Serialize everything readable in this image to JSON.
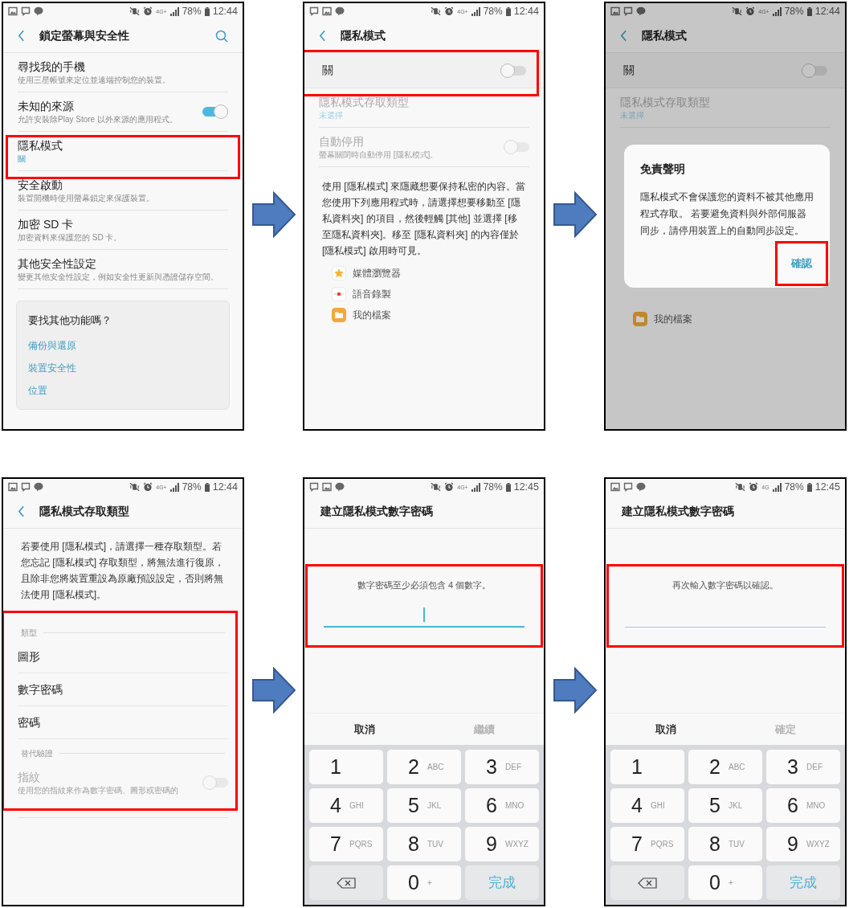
{
  "screens": [
    {
      "kind": "settings",
      "status": {
        "icons": [
          {
            "kind": "picture"
          },
          {
            "kind": "message"
          },
          {
            "kind": "chat"
          }
        ],
        "network": "4G+",
        "battery": "78%",
        "time": "12:44"
      },
      "title": "鎖定螢幕與安全性",
      "items": [
        {
          "title": "尋找我的手機",
          "summary": "使用三星帳號來定位並遠端控制您的裝置。",
          "disabled": false
        },
        {
          "title": "未知的來源",
          "summary": "允許安裝除Play Store 以外來源的應用程式。",
          "toggle": {
            "on": true
          },
          "disabled": false
        },
        {
          "title": "隱私模式",
          "value": "關",
          "disabled": false,
          "highlighted": true
        },
        {
          "title": "安全啟動",
          "summary": "裝置開機時使用螢幕鎖定來保護裝置。",
          "disabled": false
        },
        {
          "title": "加密 SD 卡",
          "summary": "加密資料來保護您的 SD 卡。",
          "disabled": false
        },
        {
          "title": "其他安全性設定",
          "summary": "變更其他安全性設定，例如安全性更新與憑證儲存空間。",
          "disabled": false
        }
      ],
      "card": {
        "title": "要找其他功能嗎？",
        "links": [
          "備份與還原",
          "裝置安全性",
          "位置"
        ]
      }
    },
    {
      "kind": "privacy",
      "status": {
        "icons": [
          {
            "kind": "message"
          },
          {
            "kind": "picture"
          },
          {
            "kind": "chat"
          }
        ],
        "network": "4G+",
        "battery": "78%",
        "time": "12:44"
      },
      "title": "隱私模式",
      "master": {
        "label": "關",
        "on": false,
        "highlighted": true
      },
      "items": [
        {
          "title": "隱私模式存取類型",
          "value": "未選擇",
          "disabled": true
        },
        {
          "title": "自動停用",
          "summary": "螢幕關閉時自動停用 [隱私模式]。",
          "toggle": {
            "on": false
          },
          "disabled": true
        }
      ],
      "description": "使用 [隱私模式] 來隱藏想要保持私密的內容。當您使用下列應用程式時，請選擇想要移動至 [隱私資料夾] 的項目，然後輕觸 [其他] 並選擇 [移至隱私資料夾]。移至 [隱私資料夾] 的內容僅於 [隱私模式] 啟用時可見。",
      "apps": [
        {
          "kind": "star",
          "name": "媒體瀏覽器"
        },
        {
          "kind": "record",
          "name": "語音錄製"
        },
        {
          "kind": "folder",
          "name": "我的檔案"
        }
      ]
    },
    {
      "kind": "privacy",
      "status": {
        "icons": [
          {
            "kind": "picture"
          },
          {
            "kind": "message"
          },
          {
            "kind": "chat"
          }
        ],
        "network": "4G+",
        "battery": "78%",
        "time": "12:44"
      },
      "title": "隱私模式",
      "master": {
        "label": "關",
        "on": false
      },
      "items": [
        {
          "title": "隱私模式存取類型",
          "value": "未選擇",
          "disabled": true
        }
      ],
      "apps": [
        {
          "kind": "folder",
          "name": "我的檔案"
        }
      ],
      "dialog": {
        "title": "免責聲明",
        "text": "隱私模式不會保護您的資料不被其他應用程式存取。 若要避免資料與外部伺服器同步，請停用裝置上的自動同步設定。",
        "button": {
          "label": "確認",
          "highlighted": true
        }
      }
    },
    {
      "kind": "access_type",
      "status": {
        "icons": [
          {
            "kind": "picture"
          },
          {
            "kind": "message"
          },
          {
            "kind": "chat"
          }
        ],
        "network": "4G+",
        "battery": "78%",
        "time": "12:44"
      },
      "title": "隱私模式存取類型",
      "description": "若要使用 [隱私模式]，請選擇一種存取類型。若您忘記 [隱私模式] 存取類型，將無法進行復原，且除非您將裝置重設為原廠預設設定，否則將無法使用 [隱私模式]。",
      "choices": {
        "highlighted": true,
        "sections": [
          {
            "header": "類型",
            "items": [
              {
                "title": "圖形",
                "disabled": false
              },
              {
                "title": "數字密碼",
                "disabled": false
              },
              {
                "title": "密碼",
                "disabled": false
              }
            ]
          },
          {
            "header": "替代驗證",
            "items": [
              {
                "title": "指紋",
                "summary": "使用您的指紋來作為數字密碼、圖形或密碼的",
                "toggle": {
                  "on": false
                },
                "disabled": true
              }
            ]
          }
        ]
      }
    },
    {
      "kind": "pin",
      "status": {
        "icons": [
          {
            "kind": "message"
          },
          {
            "kind": "picture"
          },
          {
            "kind": "chat"
          }
        ],
        "network": "4G+",
        "battery": "78%",
        "time": "12:45"
      },
      "title": "建立隱私模式數字密碼",
      "prompt": {
        "text": "數字密碼至少必須包含 4 個數字。",
        "focused": true,
        "highlighted": true
      },
      "actions": [
        {
          "label": "取消",
          "disabled": false
        },
        {
          "label": "繼續",
          "disabled": true
        }
      ],
      "keys": [
        {
          "kind": "digit",
          "digit": "1"
        },
        {
          "kind": "digit",
          "digit": "2",
          "letters": "ABC"
        },
        {
          "kind": "digit",
          "digit": "3",
          "letters": "DEF"
        },
        {
          "kind": "digit",
          "digit": "4",
          "letters": "GHI"
        },
        {
          "kind": "digit",
          "digit": "5",
          "letters": "JKL"
        },
        {
          "kind": "digit",
          "digit": "6",
          "letters": "MNO"
        },
        {
          "kind": "digit",
          "digit": "7",
          "letters": "PQRS"
        },
        {
          "kind": "digit",
          "digit": "8",
          "letters": "TUV"
        },
        {
          "kind": "digit",
          "digit": "9",
          "letters": "WXYZ"
        },
        {
          "kind": "backspace"
        },
        {
          "kind": "digit",
          "digit": "0",
          "letters": "+"
        },
        {
          "kind": "done",
          "label": "完成"
        }
      ]
    },
    {
      "kind": "pin",
      "status": {
        "icons": [
          {
            "kind": "picture"
          },
          {
            "kind": "message"
          },
          {
            "kind": "chat"
          }
        ],
        "network": "4G",
        "battery": "78%",
        "time": "12:45"
      },
      "title": "建立隱私模式數字密碼",
      "prompt": {
        "text": "再次輸入數字密碼以確認。",
        "focused": false,
        "highlighted": true
      },
      "actions": [
        {
          "label": "取消",
          "disabled": false
        },
        {
          "label": "確定",
          "disabled": true
        }
      ],
      "keys": [
        {
          "kind": "digit",
          "digit": "1"
        },
        {
          "kind": "digit",
          "digit": "2",
          "letters": "ABC"
        },
        {
          "kind": "digit",
          "digit": "3",
          "letters": "DEF"
        },
        {
          "kind": "digit",
          "digit": "4",
          "letters": "GHI"
        },
        {
          "kind": "digit",
          "digit": "5",
          "letters": "JKL"
        },
        {
          "kind": "digit",
          "digit": "6",
          "letters": "MNO"
        },
        {
          "kind": "digit",
          "digit": "7",
          "letters": "PQRS"
        },
        {
          "kind": "digit",
          "digit": "8",
          "letters": "TUV"
        },
        {
          "kind": "digit",
          "digit": "9",
          "letters": "WXYZ"
        },
        {
          "kind": "backspace"
        },
        {
          "kind": "digit",
          "digit": "0",
          "letters": "+"
        },
        {
          "kind": "done",
          "label": "完成"
        }
      ]
    }
  ]
}
